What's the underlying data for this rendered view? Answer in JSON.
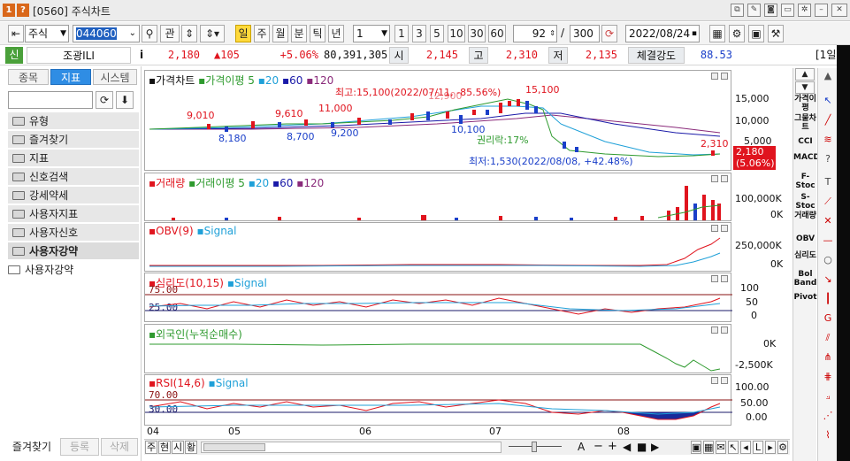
{
  "window": {
    "badge1": "1",
    "badge2": "?",
    "title": "[0560] 주식차트"
  },
  "toolbar": {
    "market": "주식",
    "code": "044060",
    "btn_gwan": "관",
    "periods": [
      "일",
      "주",
      "월",
      "분",
      "틱",
      "년"
    ],
    "active_period": "일",
    "interval_value": "1",
    "quick_intervals": [
      "1",
      "3",
      "5",
      "10",
      "30",
      "60"
    ],
    "count_value": "92",
    "count_sep": "/",
    "count_total": "300",
    "date": "2022/08/24"
  },
  "quote": {
    "tag": "신",
    "name": "조광ILI",
    "info": "i",
    "price": "2,180",
    "change": "▲105",
    "change_pct": "+5.06%",
    "volume": "80,391,305",
    "open_label": "시",
    "open": "2,145",
    "high_label": "고",
    "high": "2,310",
    "low_label": "저",
    "low": "2,135",
    "strength_label": "체결강도",
    "strength": "88.53",
    "tail": "[1일"
  },
  "left_panel": {
    "tabs": [
      "종목",
      "지표",
      "시스템"
    ],
    "active_tab": "지표",
    "items": [
      "유형",
      "즐겨찾기",
      "지표",
      "신호검색",
      "강세약세",
      "사용자지표",
      "사용자신호",
      "사용자강약",
      "사용자강약"
    ],
    "bottom_buttons": [
      "즐겨찾기",
      "등록",
      "삭제"
    ]
  },
  "panels": {
    "price": {
      "title": "가격차트",
      "ma_label": "가격이평 5",
      "ma": [
        "20",
        "60",
        "120"
      ],
      "ann_high": "최고:15,100(2022/07/11, -85.56%)",
      "ann_high_val": "15,100",
      "ann_high_ghost": "12,900",
      "ann_right": "권리락:17%",
      "ann_low": "최저:1,530(2022/08/08, +42.48%)",
      "labels": [
        "9,010",
        "8,180",
        "9,610",
        "8,700",
        "11,000",
        "9,200",
        "10,100",
        "2,310"
      ],
      "scale": [
        "15,000",
        "10,000",
        "5,000"
      ],
      "current": "2,180",
      "current_pct": "(5.06%)"
    },
    "volume": {
      "title": "거래량",
      "ma_label": "거래이평 5",
      "ma": [
        "20",
        "60",
        "120"
      ],
      "scale": [
        "100,000K",
        "0K"
      ]
    },
    "obv": {
      "title": "OBV(9)",
      "signal": "Signal",
      "scale": [
        "250,000K",
        "0K"
      ]
    },
    "psy": {
      "title": "심리도(10,15)",
      "signal": "Signal",
      "level_hi": "75.00",
      "level_lo": "25.00",
      "scale": [
        "100",
        "50",
        "0"
      ]
    },
    "foreign": {
      "title": "외국인(누적순매수)",
      "scale": [
        "0K",
        "-2,500K"
      ]
    },
    "rsi": {
      "title": "RSI(14,6)",
      "signal": "Signal",
      "level_hi": "70.00",
      "level_lo": "30.00",
      "scale": [
        "100.00",
        "50.00",
        "0.00"
      ]
    }
  },
  "x_axis": [
    "04",
    "05",
    "06",
    "07",
    "08"
  ],
  "bottom_bar": {
    "btns": [
      "주",
      "현",
      "시",
      "황"
    ],
    "symbols": [
      "A",
      "−",
      "+",
      "◀",
      "■",
      "▶"
    ]
  },
  "right_toolbar": [
    "가격이평",
    "그물차트",
    "CCI",
    "MACD",
    "F-Stoc",
    "S-Stoc",
    "거래량",
    "OBV",
    "심리도",
    "Bol Band",
    "Pivot"
  ],
  "colors": {
    "up": "#e0141e",
    "down": "#1a3fc9",
    "ma5": "#2e9a2e",
    "ma20": "#1fa0d8",
    "ma60": "#1a1aa8",
    "ma120": "#8a2a7a",
    "tab_active": "#2f8de4",
    "period_active": "#ffd93a"
  }
}
